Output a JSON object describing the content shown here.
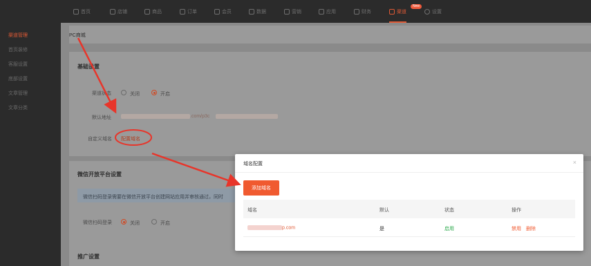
{
  "topnav": {
    "items": [
      {
        "label": "首页",
        "icon": "home-icon"
      },
      {
        "label": "店铺",
        "icon": "shop-icon"
      },
      {
        "label": "商品",
        "icon": "goods-icon"
      },
      {
        "label": "订单",
        "icon": "order-icon"
      },
      {
        "label": "会员",
        "icon": "user-icon"
      },
      {
        "label": "数据",
        "icon": "chart-icon"
      },
      {
        "label": "营销",
        "icon": "tag-icon"
      },
      {
        "label": "应用",
        "icon": "app-icon"
      },
      {
        "label": "财务",
        "icon": "finance-icon"
      },
      {
        "label": "渠道",
        "icon": "channel-icon",
        "active": true
      },
      {
        "label": "设置",
        "icon": "gear-icon"
      }
    ],
    "new_badge": "New"
  },
  "sidebar": {
    "items": [
      {
        "label": "渠道管理",
        "active": true
      },
      {
        "label": "首页装修"
      },
      {
        "label": "客服设置"
      },
      {
        "label": "底部设置"
      },
      {
        "label": "文章管理"
      },
      {
        "label": "文章分类"
      }
    ]
  },
  "page": {
    "breadcrumb": "PC商城",
    "basic": {
      "title": "基础设置",
      "status_label": "渠道状态",
      "off_label": "关闭",
      "on_label": "开启",
      "default_url_label": "默认地址",
      "default_url_suffix": ".com/p3c",
      "custom_domain_label": "自定义域名",
      "config_link": "配置域名"
    },
    "wechat": {
      "title": "微信开放平台设置",
      "notice": "微信扫码登录需要在微信开放平台创建网站应用并审核通过，同时",
      "login_label": "微信扫码登录",
      "off_label": "关闭",
      "on_label": "开启"
    },
    "promo": {
      "title": "推广设置"
    }
  },
  "modal": {
    "title": "域名配置",
    "close": "×",
    "add_button": "添加域名",
    "columns": [
      "域名",
      "默认",
      "状态",
      "操作"
    ],
    "rows": [
      {
        "domain": "p.com",
        "default": "是",
        "status": "启用",
        "actions": [
          "禁用",
          "删除"
        ]
      }
    ]
  },
  "colors": {
    "accent": "#f05a30",
    "status_green": "#2aa84a",
    "annotation_red": "#e8352a"
  }
}
